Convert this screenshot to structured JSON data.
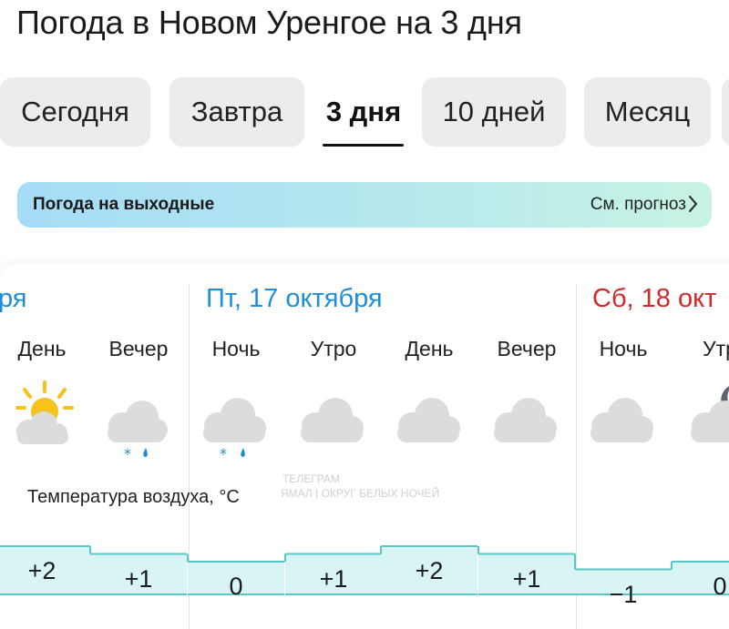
{
  "title": "Погода в Новом Уренгое на 3 дня",
  "tabs": [
    {
      "label": "Сегодня",
      "active": false
    },
    {
      "label": "Завтра",
      "active": false
    },
    {
      "label": "3 дня",
      "active": true
    },
    {
      "label": "10 дней",
      "active": false
    },
    {
      "label": "Месяц",
      "active": false
    }
  ],
  "banner": {
    "title": "Погода на выходные",
    "link": "См. прогноз"
  },
  "days": [
    {
      "label": "ря",
      "color": "#1e8fd6"
    },
    {
      "label": "Пт, 17 октября",
      "color": "#1e8fd6"
    },
    {
      "label": "Сб, 18 окт",
      "color": "#d22a2a"
    }
  ],
  "periods": [
    {
      "label": "День",
      "temp": "+2",
      "temp_value": 2,
      "icon": "sun-cloud-icon"
    },
    {
      "label": "Вечер",
      "temp": "+1",
      "temp_value": 1,
      "icon": "moon-cloud-snow-rain-icon"
    },
    {
      "label": "Ночь",
      "temp": "0",
      "temp_value": 0,
      "icon": "cloud-snow-rain-icon"
    },
    {
      "label": "Утро",
      "temp": "+1",
      "temp_value": 1,
      "icon": "cloud-icon"
    },
    {
      "label": "День",
      "temp": "+2",
      "temp_value": 2,
      "icon": "cloud-icon"
    },
    {
      "label": "Вечер",
      "temp": "+1",
      "temp_value": 1,
      "icon": "cloud-icon"
    },
    {
      "label": "Ночь",
      "temp": "−1",
      "temp_value": -1,
      "icon": "cloud-icon"
    },
    {
      "label": "Утр",
      "temp": "0",
      "temp_value": 0,
      "icon": "moon-cloud-icon"
    }
  ],
  "air_label": "Температура воздуха, °C",
  "watermark": [
    "ТЕЛЕГРАМ",
    "ЯМАЛ | ОКРУГ БЕЛЫХ НОЧЕЙ"
  ],
  "colors": {
    "accent": "#1e8fd6",
    "weekend": "#d22a2a",
    "temp_fill": "#d9f4f4",
    "temp_line": "#5bc6c8",
    "sun": "#f6c21c"
  }
}
